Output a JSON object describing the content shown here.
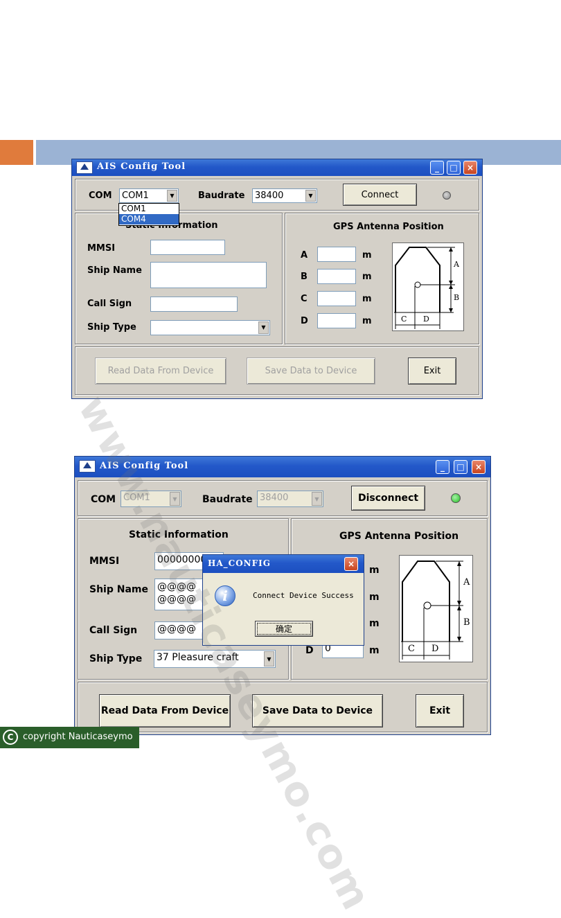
{
  "app": {
    "title": "AIS Config Tool",
    "min_glyph": "_",
    "max_glyph": "□",
    "close_glyph": "×"
  },
  "window1": {
    "com_label": "COM",
    "com_value": "COM1",
    "baudrate_label": "Baudrate",
    "baudrate_value": "38400",
    "connect_label": "Connect",
    "status_led": "gray",
    "com_dropdown_options": [
      "COM1",
      "COM4"
    ],
    "com_dropdown_selected": "COM4",
    "static_info_title": "Static Information",
    "mmsi_label": "MMSI",
    "mmsi_value": "",
    "ship_name_label": "Ship Name",
    "ship_name_value": "",
    "call_sign_label": "Call Sign",
    "call_sign_value": "",
    "ship_type_label": "Ship Type",
    "ship_type_value": "",
    "gps_title": "GPS Antenna Position",
    "gps_rows": [
      {
        "label": "A",
        "value": "",
        "unit": "m"
      },
      {
        "label": "B",
        "value": "",
        "unit": "m"
      },
      {
        "label": "C",
        "value": "",
        "unit": "m"
      },
      {
        "label": "D",
        "value": "",
        "unit": "m"
      }
    ],
    "read_label": "Read Data From Device",
    "save_label": "Save Data to Device",
    "exit_label": "Exit"
  },
  "window2": {
    "com_label": "COM",
    "com_value": "COM1",
    "baudrate_label": "Baudrate",
    "baudrate_value": "38400",
    "connect_label": "Disconnect",
    "status_led": "green",
    "static_info_title": "Static Information",
    "mmsi_label": "MMSI",
    "mmsi_value": "00000000",
    "ship_name_label": "Ship Name",
    "ship_name_value_line1": "@@@@",
    "ship_name_value_line2": "@@@@",
    "call_sign_label": "Call Sign",
    "call_sign_value": "@@@@",
    "ship_type_label": "Ship Type",
    "ship_type_value": "37 Pleasure craft",
    "gps_title": "GPS Antenna Position",
    "gps_unit": "m",
    "gps_d_label": "D",
    "gps_d_value": "0",
    "read_label": "Read Data From Device",
    "save_label": "Save Data to Device",
    "exit_label": "Exit"
  },
  "dialog": {
    "title": "HA_CONFIG",
    "message": "Connect Device Success",
    "ok_label": "确定",
    "icon": "info-icon"
  },
  "diagram_labels": {
    "a": "A",
    "b": "B",
    "c": "C",
    "d": "D"
  },
  "watermark": "www.nauticaseymo.com",
  "copyright": {
    "symbol": "C",
    "text": "copyright Nauticaseymo"
  },
  "colors": {
    "header_orange": "#e07b3c",
    "header_blue": "#9bb3d4",
    "titlebar_blue": "#2358c9",
    "window_face": "#d4d0c8",
    "led_gray": "#8a8a8a",
    "led_green": "#22c022",
    "selection_blue": "#316ac5",
    "copyright_green": "#2a5e2a"
  }
}
